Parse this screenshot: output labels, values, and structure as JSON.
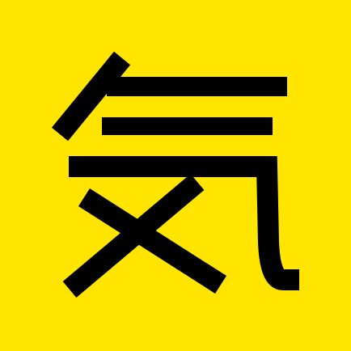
{
  "tile": {
    "character": "気",
    "background_color": "#FFE500",
    "glyph_color": "#000000",
    "icon": "kanji-ki-glyph"
  }
}
